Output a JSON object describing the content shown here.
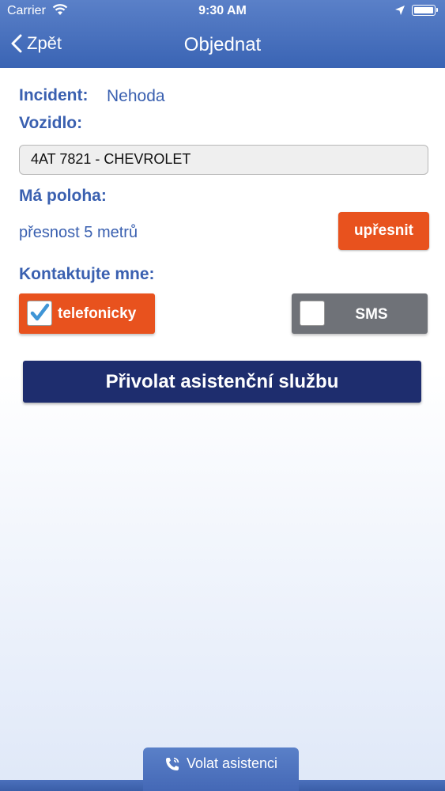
{
  "status_bar": {
    "carrier": "Carrier",
    "time": "9:30 AM"
  },
  "nav": {
    "back_label": "Zpět",
    "title": "Objednat"
  },
  "form": {
    "incident_label": "Incident:",
    "incident_value": "Nehoda",
    "vehicle_label": "Vozidlo:",
    "vehicle_value": "4AT 7821 - CHEVROLET",
    "location_label": "Má poloha:",
    "location_accuracy": "přesnost 5 metrů",
    "refine_button": "upřesnit",
    "contact_label": "Kontaktujte mne:",
    "contact_options": [
      {
        "label": "telefonicky",
        "checked": true
      },
      {
        "label": "SMS",
        "checked": false
      }
    ],
    "submit_button": "Přivolat asistenční službu"
  },
  "bottom_tab": {
    "label": "Volat asistenci",
    "icon": "phone-icon"
  },
  "colors": {
    "nav_bar": "#4a71bf",
    "label_blue": "#3a60b0",
    "accent_orange": "#e8521e",
    "inactive_gray": "#6f7278",
    "submit_navy": "#1e2d6e",
    "check_blue": "#3f95d6"
  }
}
